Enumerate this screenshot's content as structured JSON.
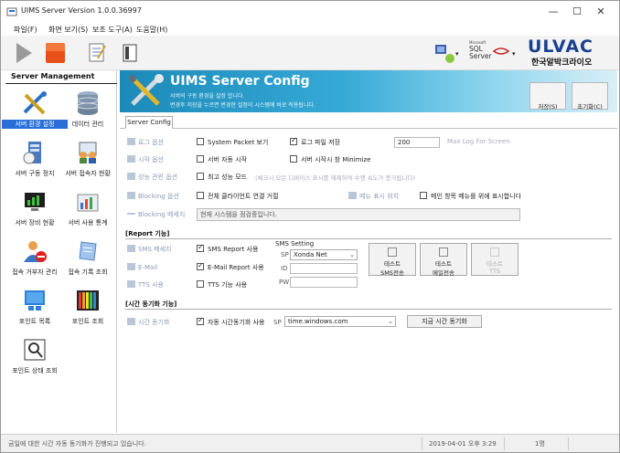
{
  "window": {
    "title": "UIMS Server Version 1.0.0.36997",
    "controls": [
      "—",
      "☐",
      "✕"
    ]
  },
  "menu": [
    "파일(F)",
    "화면 보기(S)",
    "보조 도구(A)",
    "도움말(H)"
  ],
  "toolbar": {
    "sql_logo_top": "Microsoft",
    "sql_logo": "SQL Server",
    "brand": "ULVAC",
    "brand_sub": "한국알박크라이오"
  },
  "sidebar": {
    "title": "Server Management",
    "items": [
      {
        "label": "서버 환경 설정",
        "icon": "tools-icon"
      },
      {
        "label": "데이터 관리",
        "icon": "database-icon"
      },
      {
        "label": "서버 구동 정지",
        "icon": "server-icon"
      },
      {
        "label": "서버 접속자 현황",
        "icon": "users-icon"
      },
      {
        "label": "서버 장비 현황",
        "icon": "monitor-icon"
      },
      {
        "label": "서버 사용 통계",
        "icon": "chart-icon"
      },
      {
        "label": "접속 거부자 관리",
        "icon": "block-user-icon"
      },
      {
        "label": "접속 기록 조회",
        "icon": "log-icon"
      },
      {
        "label": "포인트 목록",
        "icon": "point-list-icon"
      },
      {
        "label": "포인트 조회",
        "icon": "point-view-icon"
      },
      {
        "label": "포인트 상태 조회",
        "icon": "search-icon"
      }
    ]
  },
  "banner": {
    "title": "UIMS Server Config",
    "sub1": "서버의 구동 환경을 설정 합니다.",
    "sub2": "변경후 저장을 누르면 변경한 설정이 시스템에 바로 적용됩니다.",
    "save": "저장(S)",
    "reset": "초기화(C)"
  },
  "tab": "Server Config",
  "options": {
    "log_label": "로그 옵션",
    "system_packet": "System Packet 보기",
    "log_file_save": "로그 파일 저장",
    "log_count": "200",
    "max_log": "Max Log For Screen",
    "start_label": "시작 옵션",
    "auto_start": "서버 자동 시작",
    "minimize": "서버 시작시 창 Minimize",
    "perf_label": "성능 관련 옵션",
    "max_perf": "최고 성능 모드",
    "perf_note": "(체크시 모든 디바이스 표시를 해제하여 수행 속도가 증가됩니다)",
    "blocking_label": "Blocking 옵션",
    "block_all": "전체 클라이언트 연결 거절",
    "menu_pos_label": "메뉴 표시 위치",
    "menu_top": "메인 항목 메뉴를 위에 표시합니다",
    "blocking_msg_label": "Blocking 메세지",
    "blocking_msg": "현재 시스템을 점검중입니다."
  },
  "report": {
    "section": "[Report 기능]",
    "sms_label": "SMS 메세지",
    "sms_report": "SMS Report 사용",
    "email_label": "E-Mail",
    "email_report": "E-Mail Report 사용",
    "tts_label": "TTS 사용",
    "tts_use": "TTS 기능 사용",
    "sms_setting": "SMS Setting",
    "sp": "SP",
    "sp_value": "Xonda Net",
    "id": "ID",
    "pw": "PW",
    "btn_sms": [
      "테스트",
      "SMS전송"
    ],
    "btn_mail": [
      "테스트",
      "메일전송"
    ],
    "btn_tts": [
      "테스트",
      "TTS"
    ]
  },
  "timesync": {
    "section": "[시간 동기화 기능]",
    "label": "시간 동기화",
    "auto": "자동 시간동기화 사용",
    "sp": "SP",
    "server": "time.windows.com",
    "now_btn": "지금 시간 동기화"
  },
  "status": {
    "message": "금일에 대한 시간 자동 동기화가 진행되고 있습니다.",
    "datetime": "2019-04-01 오후 3:29",
    "count": "1명"
  },
  "colors": {
    "accent": "#2a6fd8",
    "banner": "#1c8ab8"
  }
}
